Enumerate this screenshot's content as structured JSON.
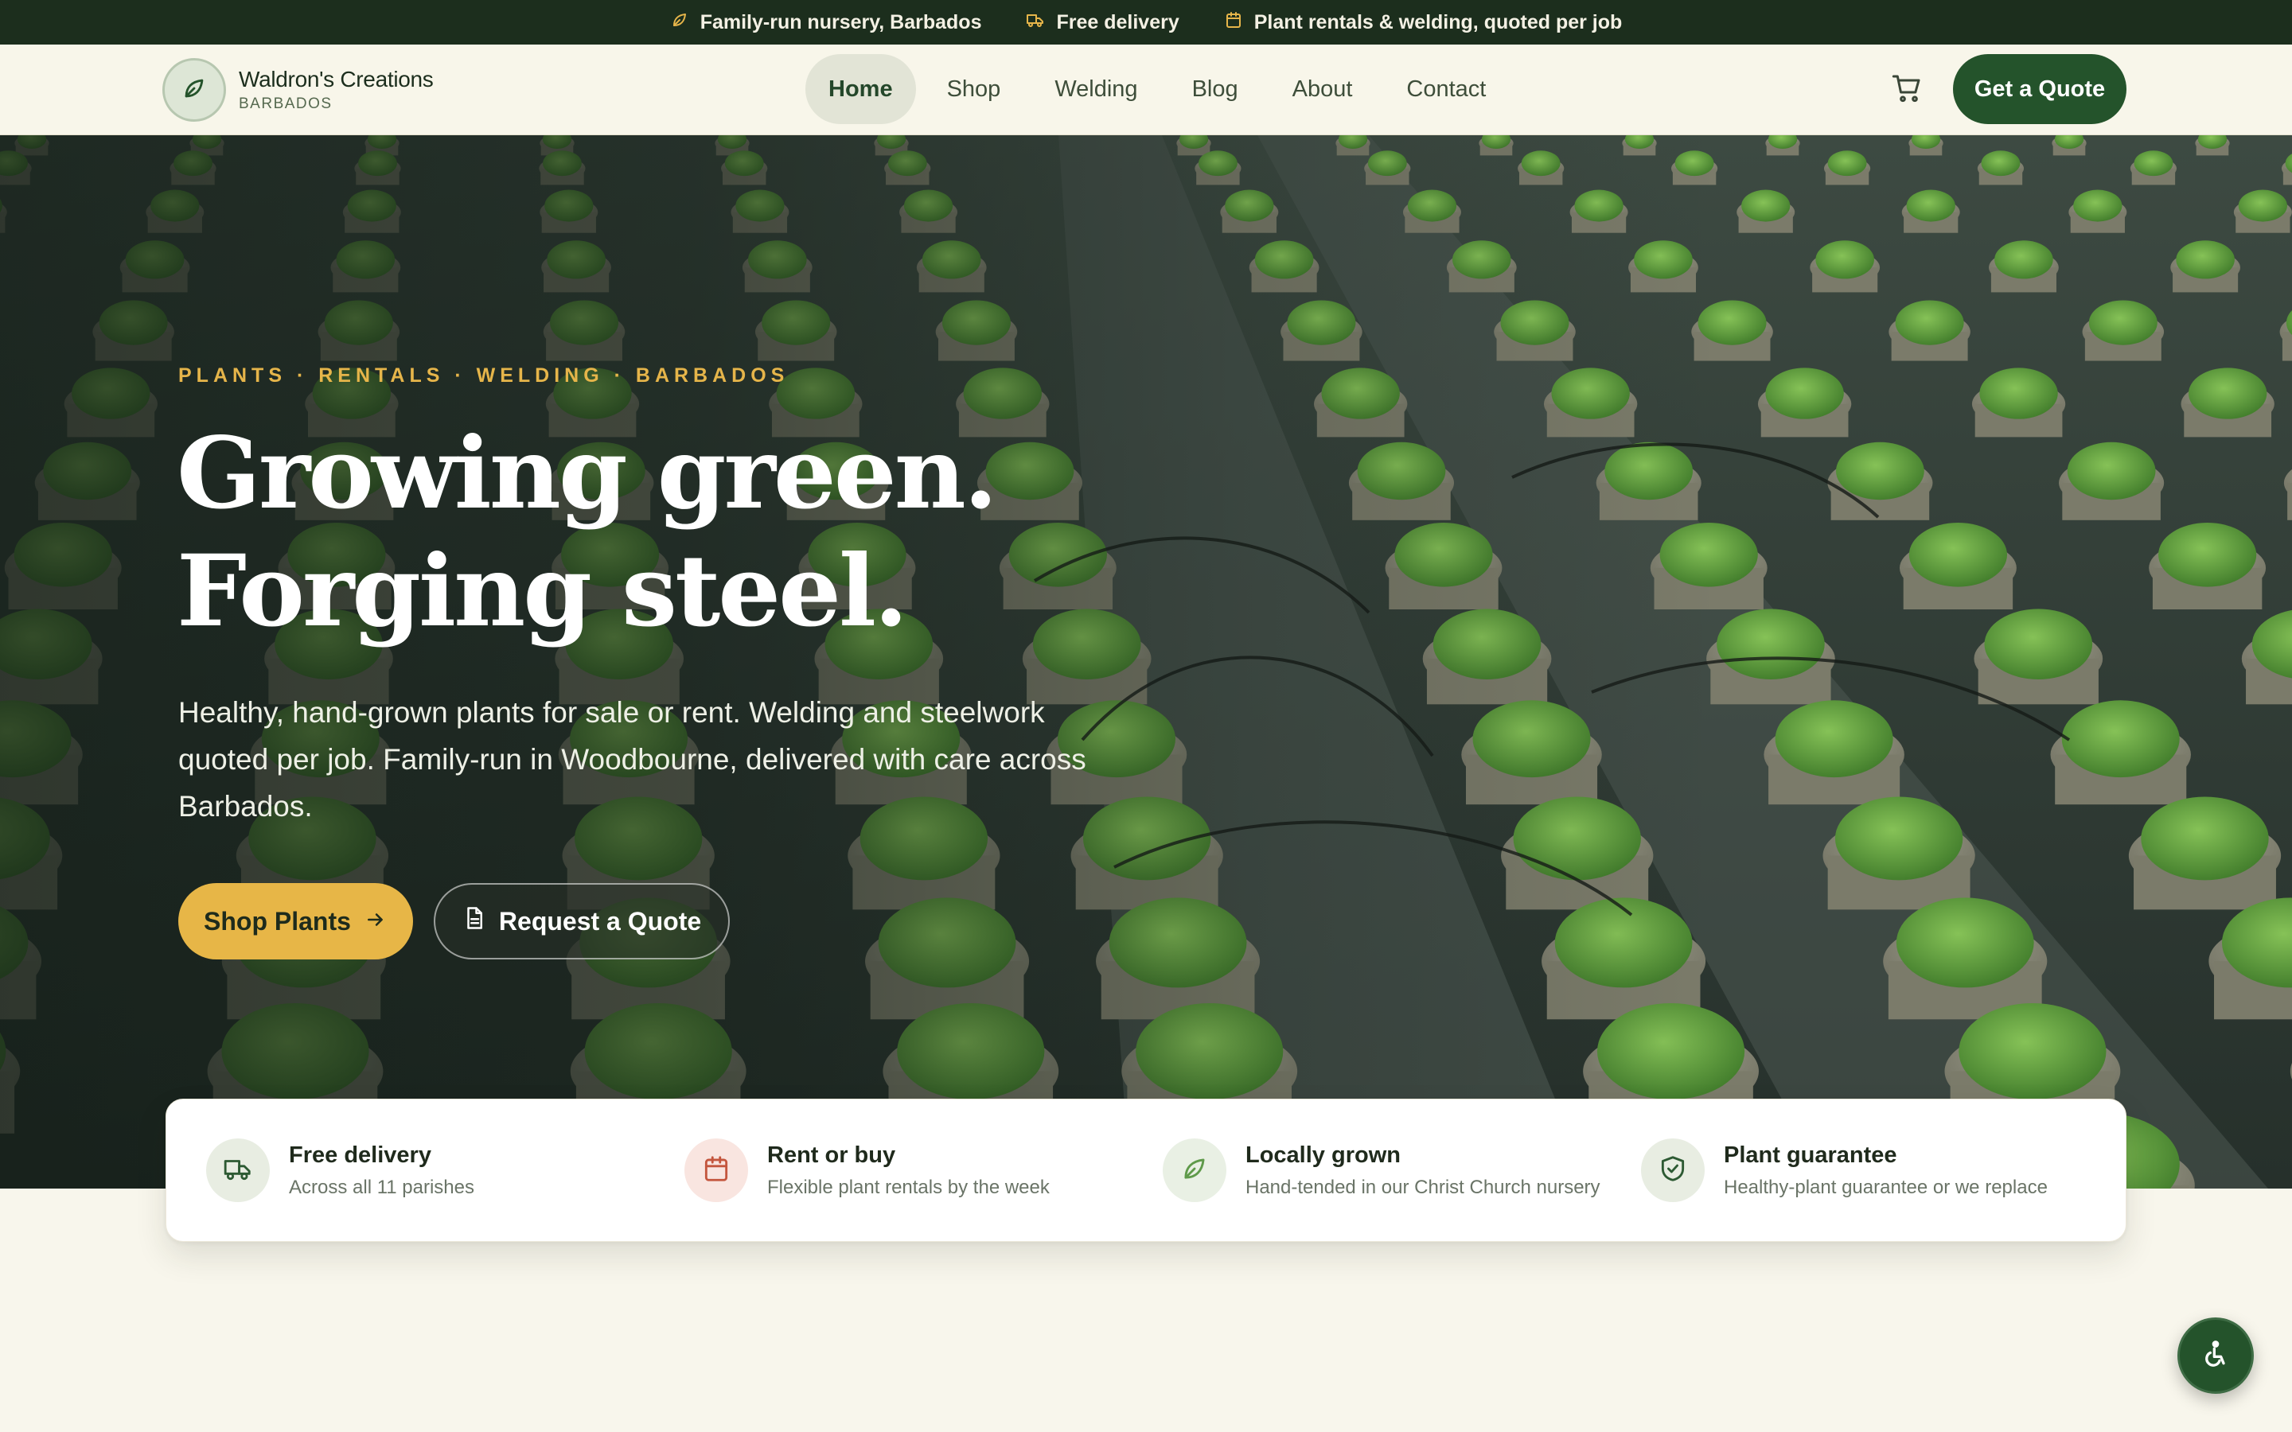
{
  "topbar": {
    "items": [
      {
        "label": "Family-run nursery, Barbados",
        "icon": "leaf-icon"
      },
      {
        "label": "Free delivery",
        "icon": "truck-icon"
      },
      {
        "label": "Plant rentals & welding, quoted per job",
        "icon": "calendar-icon"
      }
    ]
  },
  "header": {
    "brand_name": "Waldron's Creations",
    "brand_sub": "BARBADOS",
    "nav": [
      {
        "label": "Home",
        "active": true
      },
      {
        "label": "Shop",
        "active": false
      },
      {
        "label": "Welding",
        "active": false
      },
      {
        "label": "Blog",
        "active": false
      },
      {
        "label": "About",
        "active": false
      },
      {
        "label": "Contact",
        "active": false
      }
    ],
    "cta_label": "Get a Quote"
  },
  "hero": {
    "eyebrow": "PLANTS · RENTALS · WELDING · BARBADOS",
    "headline_line1": "Growing green.",
    "headline_line2": "Forging steel.",
    "lead": "Healthy, hand-grown plants for sale or rent. Welding and steelwork quoted per job. Family-run in Woodbourne, delivered with care across Barbados.",
    "primary_cta": "Shop Plants",
    "secondary_cta": "Request a Quote"
  },
  "features": [
    {
      "title": "Free delivery",
      "subtitle": "Across all 11 parishes",
      "icon": "truck-icon"
    },
    {
      "title": "Rent or buy",
      "subtitle": "Flexible plant rentals by the week",
      "icon": "calendar-icon"
    },
    {
      "title": "Locally grown",
      "subtitle": "Hand-tended in our Christ Church nursery",
      "icon": "leaf-icon"
    },
    {
      "title": "Plant guarantee",
      "subtitle": "Healthy-plant guarantee or we replace",
      "icon": "shield-check-icon"
    }
  ],
  "colors": {
    "forest": "#24532b",
    "topbar": "#1c2e1d",
    "gold": "#e7b647",
    "cream": "#f8f6ec"
  }
}
